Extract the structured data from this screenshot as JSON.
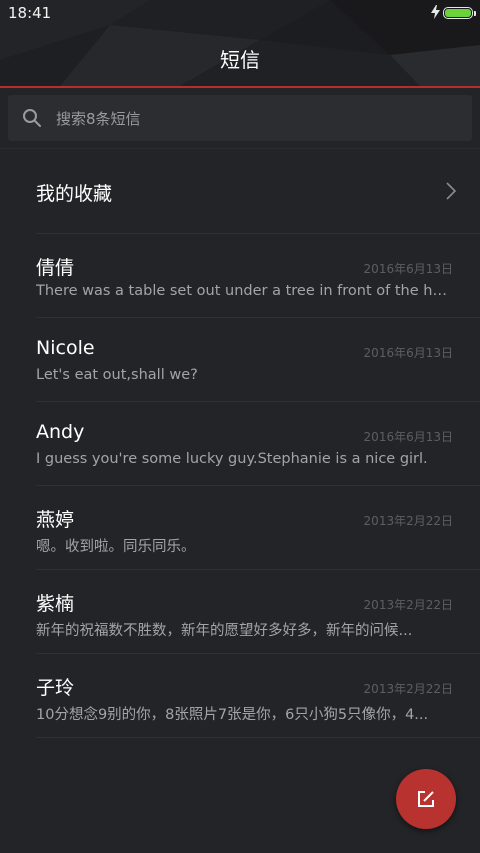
{
  "status_bar": {
    "time": "18:41",
    "battery_level": 1.0,
    "charging": true,
    "battery_color": "#6bd33a"
  },
  "header": {
    "title": "短信",
    "accent_color": "#b2302c"
  },
  "search": {
    "placeholder": "搜索8条短信",
    "icon": "search-icon"
  },
  "favorites": {
    "label": "我的收藏",
    "icon": "chevron-right-icon"
  },
  "conversations": [
    {
      "name": "倩倩",
      "date": "2016年6月13日",
      "preview": "There was a table set out under a tree in front of the ho..."
    },
    {
      "name": "Nicole",
      "date": "2016年6月13日",
      "preview": "Let's eat out,shall we?"
    },
    {
      "name": "Andy",
      "date": "2016年6月13日",
      "preview": "I guess you're some lucky guy.Stephanie is a nice girl."
    },
    {
      "name": "燕婷",
      "date": "2013年2月22日",
      "preview": "嗯。收到啦。同乐同乐。"
    },
    {
      "name": "紫楠",
      "date": "2013年2月22日",
      "preview": "新年的祝福数不胜数，新年的愿望好多好多，新年的问候..."
    },
    {
      "name": "子玲",
      "date": "2013年2月22日",
      "preview": "10分想念9别的你，8张照片7张是你，6只小狗5只像你，4..."
    }
  ],
  "fab": {
    "icon": "compose-icon",
    "color": "#b83230"
  }
}
